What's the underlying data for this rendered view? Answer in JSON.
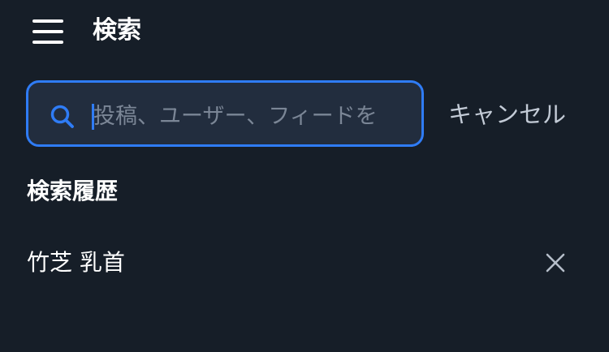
{
  "header": {
    "menu_icon": "hamburger-menu-icon",
    "title": "検索"
  },
  "search": {
    "icon": "search-icon",
    "placeholder": "投稿、ユーザー、フィードを",
    "value": "",
    "cancel_label": "キャンセル",
    "accent_color": "#2f7cf6"
  },
  "history": {
    "title": "検索履歴",
    "items": [
      {
        "label": "竹芝 乳首",
        "remove_icon": "close-icon"
      }
    ]
  }
}
